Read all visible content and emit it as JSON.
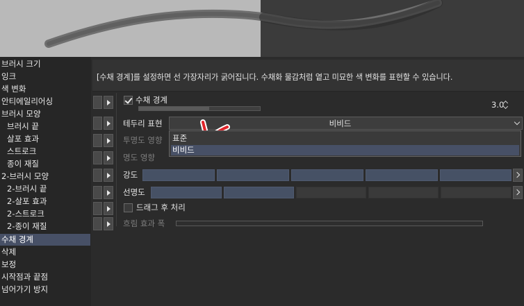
{
  "sidebar": {
    "items": [
      {
        "label": "브러시 크기"
      },
      {
        "label": "잉크"
      },
      {
        "label": "색 변화"
      },
      {
        "label": "안티에일리어싱"
      },
      {
        "label": "브러시 모양"
      },
      {
        "label": "브러시 끝"
      },
      {
        "label": "살포 효과"
      },
      {
        "label": "스트로크"
      },
      {
        "label": "종이 재질"
      },
      {
        "label": "2-브러시 모양"
      },
      {
        "label": "2-브러시 끝"
      },
      {
        "label": "2-살포 효과"
      },
      {
        "label": "2-스트로크"
      },
      {
        "label": "2-종이 재질"
      },
      {
        "label": "수채 경계",
        "selected": true
      },
      {
        "label": "삭제"
      },
      {
        "label": "보정"
      },
      {
        "label": "시작점과 끝점"
      },
      {
        "label": "넘어가기 방지"
      }
    ]
  },
  "main": {
    "description": "[수채 경계]를 설정하면 선 가장자리가 굵어집니다. 수채화 물감처럼 옅고 미묘한 색 변화를 표현할 수 있습니다.",
    "watercolor_edge": {
      "label": "수채 경계",
      "checked": true,
      "value": "3.0",
      "level": 0.58
    },
    "edge_expression": {
      "label": "테두리 표현",
      "value": "비비드",
      "options": [
        "표준",
        "비비드"
      ],
      "selected_option": "비비드"
    },
    "opacity_influence": {
      "label": "투명도 영향"
    },
    "brightness_influence": {
      "label": "명도 영향"
    },
    "strength": {
      "label": "강도",
      "segments": 5,
      "filled": 5
    },
    "sharpness": {
      "label": "선명도",
      "segments": 5,
      "filled": 2
    },
    "after_drag": {
      "label": "드래그 후 처리",
      "checked": false
    },
    "blur_width": {
      "label": "흐림 효과 폭"
    }
  },
  "colors": {
    "selection": "#475066",
    "segment_on": "#465165",
    "annotation_red": "#e0242a"
  }
}
